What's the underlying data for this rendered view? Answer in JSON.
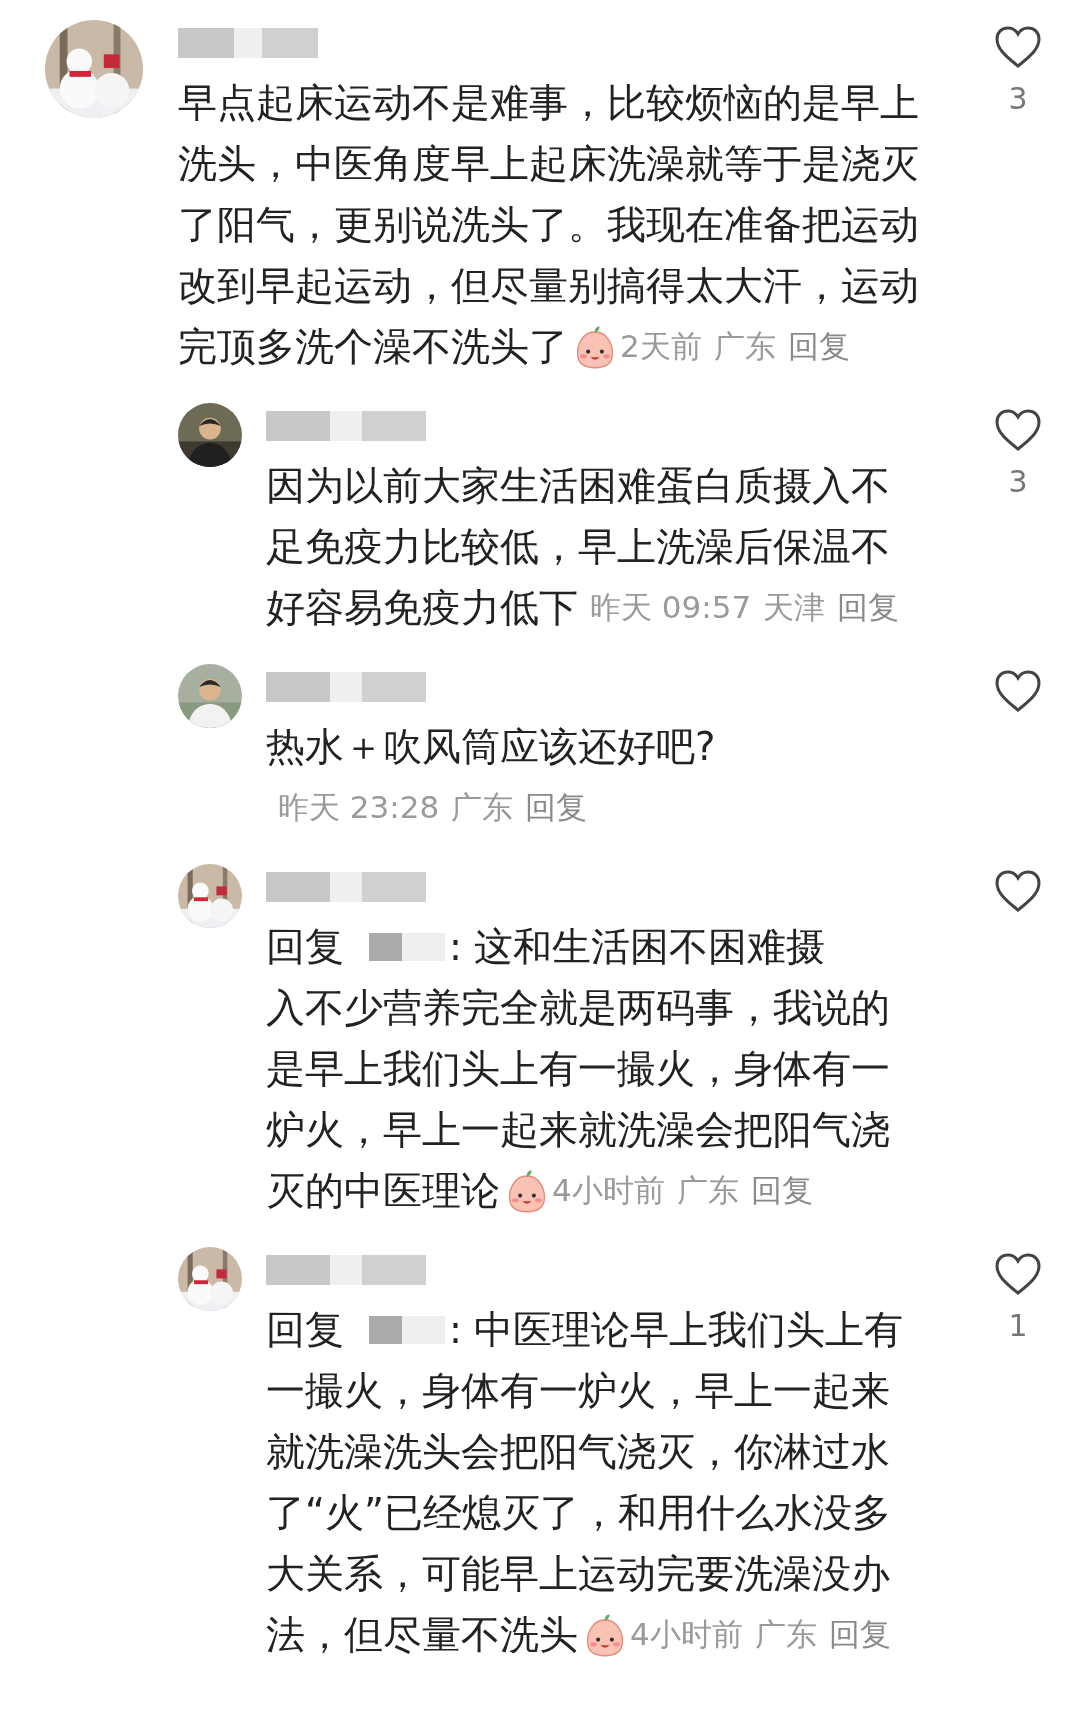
{
  "comments": [
    {
      "lines": [
        "早点起床运动不是难事，比较烦恼的是早上",
        "洗头，中医角度早上起床洗澡就等于是浇灭",
        "了阳气，更别说洗头了。我现在准备把运动",
        "改到早起运动，但尽量别搞得太大汗，运动",
        "完顶多洗个澡不洗头了"
      ],
      "emoji": true,
      "time": "2天前",
      "location": "广东",
      "reply": "回复",
      "likes": "3",
      "children": [
        {
          "lines": [
            "因为以前大家生活困难蛋白质摄入不",
            "足免疫力比较低，早上洗澡后保温不",
            "好容易免疫力低下"
          ],
          "emoji": false,
          "time": "昨天 09:57",
          "location": "天津",
          "reply": "回复",
          "likes": "3"
        },
        {
          "lines": [
            "热水＋吹风筒应该还好吧?"
          ],
          "emoji": false,
          "time": "昨天 23:28",
          "location": "广东",
          "reply": "回复"
        },
        {
          "reply_label": "回复",
          "lines": [
            ": 这和生活困不困难摄",
            "入不少营养完全就是两码事，我说的",
            "是早上我们头上有一撮火，身体有一",
            "炉火，早上一起来就洗澡会把阳气浇",
            "灭的中医理论"
          ],
          "emoji": true,
          "time": "4小时前",
          "location": "广东",
          "reply": "回复"
        },
        {
          "reply_label": "回复",
          "lines": [
            ": 中医理论早上我们头上有",
            "一撮火，身体有一炉火，早上一起来",
            "就洗澡洗头会把阳气浇灭，你淋过水",
            "了“火”已经熄灭了，和用什么水没多",
            "大关系，可能早上运动完要洗澡没办",
            "法，但尽量不洗头"
          ],
          "emoji": true,
          "time": "4小时前",
          "location": "广东",
          "reply": "回复",
          "likes": "1"
        }
      ]
    }
  ]
}
